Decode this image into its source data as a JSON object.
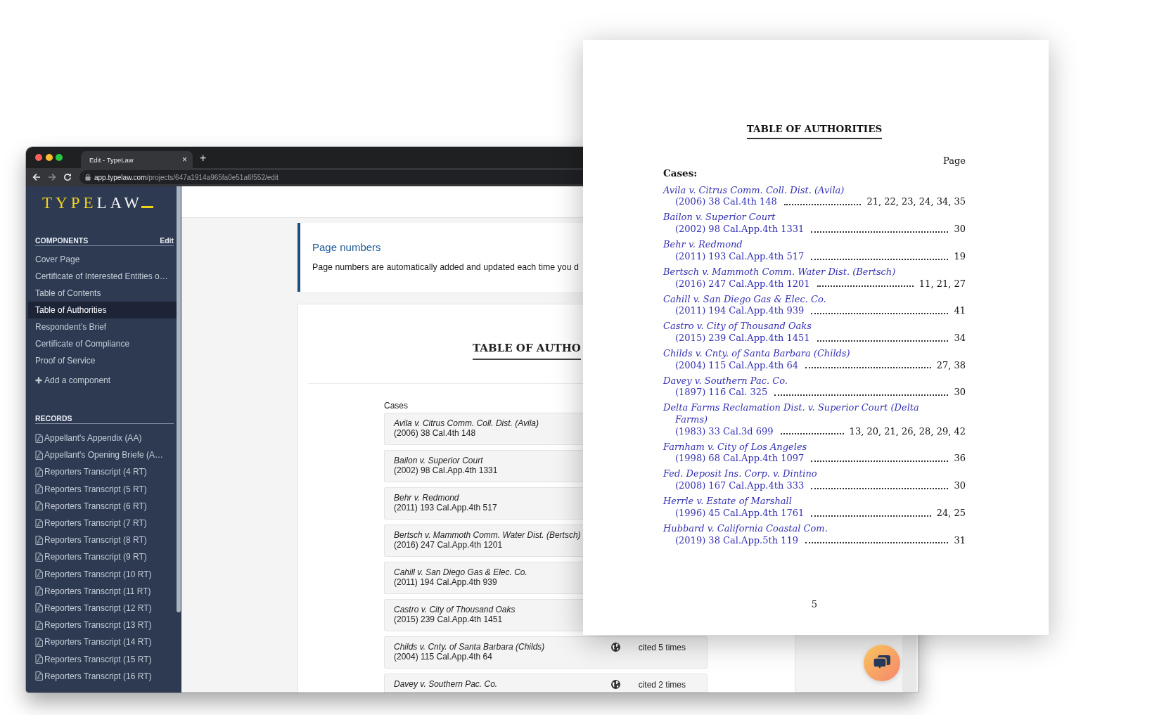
{
  "browser": {
    "tab_title": "Edit - TypeLaw",
    "tab_close": "×",
    "new_tab": "+",
    "url_host": "app.typelaw.com",
    "url_path": "/projects/647a1914a965fa0e51a6f552/edit"
  },
  "sidebar": {
    "logo": {
      "lead": "TYPE",
      "rest": "LAW"
    },
    "components": {
      "title": "COMPONENTS",
      "action": "Edit",
      "items": [
        {
          "label": "Cover Page",
          "selected": false
        },
        {
          "label": "Certificate of Interested Entities o…",
          "selected": false
        },
        {
          "label": "Table of Contents",
          "selected": false
        },
        {
          "label": "Table of Authorities",
          "selected": true
        },
        {
          "label": "Respondent’s Brief",
          "selected": false
        },
        {
          "label": "Certificate of Compliance",
          "selected": false
        },
        {
          "label": "Proof of Service",
          "selected": false
        }
      ],
      "add": "Add a component"
    },
    "records": {
      "title": "RECORDS",
      "items": [
        "Appellant's Appendix (AA)",
        "Appellant's Opening Briefe (A…",
        "Reporters Transcript (4 RT)",
        "Reporters Transcript (5 RT)",
        "Reporters Transcript (6 RT)",
        "Reporters Transcript (7 RT)",
        "Reporters Transcript (8 RT)",
        "Reporters Transcript (9 RT)",
        "Reporters Transcript (10 RT)",
        "Reporters Transcript (11 RT)",
        "Reporters Transcript (12 RT)",
        "Reporters Transcript (13 RT)",
        "Reporters Transcript (14 RT)",
        "Reporters Transcript (15 RT)",
        "Reporters Transcript (16 RT)"
      ]
    }
  },
  "notice": {
    "title": "Page numbers",
    "text": "Page numbers are automatically added and updated each time you d"
  },
  "editor": {
    "heading": "TABLE OF AUTHO",
    "section": "Cases",
    "cases": [
      {
        "title": "Avila v. Citrus Comm. Coll. Dist. (Avila)",
        "citation": "(2006) 38 Cal.4th 148"
      },
      {
        "title": "Bailon v. Superior Court",
        "citation": "(2002) 98 Cal.App.4th 1331"
      },
      {
        "title": "Behr v. Redmond",
        "citation": "(2011) 193 Cal.App.4th 517"
      },
      {
        "title": "Bertsch v. Mammoth Comm. Water Dist. (Bertsch)",
        "citation": "(2016) 247 Cal.App.4th 1201"
      },
      {
        "title": "Cahill v. San Diego Gas & Elec. Co.",
        "citation": "(2011) 194 Cal.App.4th 939"
      },
      {
        "title": "Castro v. City of Thousand Oaks",
        "citation": "(2015) 239 Cal.App.4th 1451"
      },
      {
        "title": "Childs v. Cnty. of Santa Barbara (Childs)",
        "citation": "(2004) 115 Cal.App.4th 64",
        "cited": "cited 5 times"
      },
      {
        "title": "Davey v. Southern Pac. Co.",
        "cited": "cited 2 times"
      }
    ]
  },
  "preview": {
    "heading": "TABLE OF AUTHORITIES",
    "page_label": "Page",
    "section": "Cases:",
    "entries": [
      {
        "title": "Avila v. Citrus Comm. Coll. Dist. (Avila)",
        "citation": "(2006) 38 Cal.4th 148",
        "pages": "21, 22, 23, 24, 34, 35"
      },
      {
        "title": "Bailon v. Superior Court",
        "citation": "(2002) 98 Cal.App.4th 1331",
        "pages": "30"
      },
      {
        "title": "Behr v. Redmond",
        "citation": "(2011) 193 Cal.App.4th 517",
        "pages": "19"
      },
      {
        "title": "Bertsch v. Mammoth Comm. Water Dist. (Bertsch)",
        "citation": "(2016) 247 Cal.App.4th 1201",
        "pages": "11, 21, 27"
      },
      {
        "title": "Cahill v. San Diego Gas & Elec. Co.",
        "citation": "(2011) 194 Cal.App.4th 939",
        "pages": "41"
      },
      {
        "title": "Castro v. City of Thousand Oaks",
        "citation": "(2015) 239 Cal.App.4th 1451",
        "pages": "34"
      },
      {
        "title": "Childs v. Cnty. of Santa Barbara (Childs)",
        "citation": "(2004) 115 Cal.App.4th 64",
        "pages": "27, 38"
      },
      {
        "title": "Davey v. Southern Pac. Co.",
        "citation": "(1897) 116 Cal. 325",
        "pages": "30"
      },
      {
        "title": "Delta Farms Reclamation Dist. v. Superior Court (Delta Farms)",
        "citation": "(1983) 33 Cal.3d 699",
        "pages": "13, 20, 21, 26, 28, 29, 42"
      },
      {
        "title": "Farnham v. City of Los Angeles",
        "citation": "(1998) 68 Cal.App.4th 1097",
        "pages": "36"
      },
      {
        "title": "Fed. Deposit Ins. Corp. v. Dintino",
        "citation": "(2008) 167 Cal.App.4th 333",
        "pages": "30"
      },
      {
        "title": "Herrle v. Estate of Marshall",
        "citation": "(1996) 45 Cal.App.4th 1761",
        "pages": "24, 25"
      },
      {
        "title": "Hubbard v. California Coastal Com.",
        "citation": "(2019) 38 Cal.App.5th 119",
        "pages": "31"
      }
    ],
    "page_number": "5"
  }
}
